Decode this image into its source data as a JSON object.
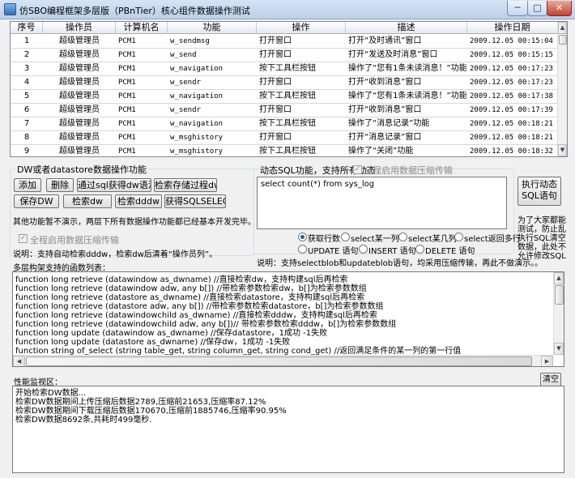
{
  "window": {
    "title": "仿SBO编程框架多层版（PBnTier）核心组件数据操作测试",
    "min": "─",
    "max": "□",
    "close": "✕"
  },
  "grid": {
    "columns": [
      "序号",
      "操作员",
      "计算机名",
      "功能",
      "操作",
      "描述",
      "操作日期"
    ],
    "rows": [
      [
        "1",
        "超级管理员",
        "PCM1",
        "w_sendmsg",
        "打开窗口",
        "打开“及时通讯”窗口",
        "2009.12.05 00:15:04"
      ],
      [
        "2",
        "超级管理员",
        "PCM1",
        "w_send",
        "打开窗口",
        "打开“发送及时消息”窗口",
        "2009.12.05 00:15:15"
      ],
      [
        "3",
        "超级管理员",
        "PCM1",
        "w_navigation",
        "按下工具栏按钮",
        "操作了“您有1条未读消息！”功能",
        "2009.12.05 00:17:23"
      ],
      [
        "4",
        "超级管理员",
        "PCM1",
        "w_sendr",
        "打开窗口",
        "打开“收到消息”窗口",
        "2009.12.05 00:17:23"
      ],
      [
        "5",
        "超级管理员",
        "PCM1",
        "w_navigation",
        "按下工具栏按钮",
        "操作了“您有1条未读消息！”功能",
        "2009.12.05 00:17:38"
      ],
      [
        "6",
        "超级管理员",
        "PCM1",
        "w_sendr",
        "打开窗口",
        "打开“收到消息”窗口",
        "2009.12.05 00:17:39"
      ],
      [
        "7",
        "超级管理员",
        "PCM1",
        "w_navigation",
        "按下工具栏按钮",
        "操作了“消息记录”功能",
        "2009.12.05 00:18:21"
      ],
      [
        "8",
        "超级管理员",
        "PCM1",
        "w_msghistory",
        "打开窗口",
        "打开“消息记录”窗口",
        "2009.12.05 00:18:21"
      ],
      [
        "9",
        "超级管理员",
        "PCM1",
        "w_msghistory",
        "按下工具栏按钮",
        "操作了“关闭”功能",
        "2009.12.05 00:18:32"
      ]
    ]
  },
  "dw_group": {
    "title": "DW或者datastore数据操作功能",
    "buttons": [
      "添加",
      "删除",
      "通过sql获得dw语法",
      "检索存储过程dw",
      "保存DW",
      "检索dw",
      "检索dddw",
      "获得SQLSELECT"
    ],
    "other_text": "其他功能暂不演示，两层下所有数据操作功能都已经基本开发完毕。",
    "compress_label": "全程启用数据压缩传输",
    "note": "说明：支持自动检索dddw，检索dw后清着“操作员列”。"
  },
  "sql_group": {
    "title": "动态SQL功能，支持所有动态",
    "compress_label": "全程启用数据压缩传输",
    "query": "select count(*) from sys_log",
    "exec_button": "执行动态SQL语句",
    "side_note": [
      "为了大家都能",
      "测试，防止乱",
      "执行SQL清空",
      "数据，此处不",
      "允许修改SQL"
    ],
    "radios": [
      {
        "label": "获取行数",
        "selected": true
      },
      {
        "label": "select某一列",
        "selected": false
      },
      {
        "label": "select某几列",
        "selected": false
      },
      {
        "label": "select返回多行",
        "selected": false
      },
      {
        "label": "UPDATE 语句",
        "selected": false
      },
      {
        "label": "INSERT 语句",
        "selected": false
      },
      {
        "label": "DELETE 语句",
        "selected": false
      }
    ],
    "note": "说明：支持selectblob和updateblob语句，均采用压缩传输，再此不做演示。。"
  },
  "functions": {
    "label": "多层构架支持的函数列表：",
    "lines": [
      "function long retrieve (datawindow as_dwname) //直接检索dw，支持构建sql后再检索",
      "function long retrieve (datawindow adw, any b[]) //带检索参数检索dw，b[]为检索参数数组",
      "function long retrieve (datastore as_dwname) //直接检索datastore，支持构建sql后再检索",
      "function long retrieve (datastore adw, any b[]) //带检索参数检索datastore，b[]为检索参数数组",
      "function long retrieve (datawindowchild as_dwname) //直接检索dddw，支持构建sql后再检索",
      "function long retrieve (datawindowchild adw, any b[])// 带检索参数检索dddw，b[]为检索参数数组",
      "function long update (datawindow as_dwname) //保存datastore，1成功 -1失败",
      "function long update (datastore as_dwname) //保存dw，1成功 -1失败",
      "function string of_select (string table_get, string column_get, string cond_get) //返回满足条件的某一列的第一行值"
    ]
  },
  "perf": {
    "label": "性能监视区：",
    "clear_button": "清空",
    "lines": [
      "开始检索DW数据...",
      "检索DW数据期间上传压缩后数据2789,压缩前21653,压缩率87.12%",
      "检索DW数据期间下载压缩后数据170670,压缩前1885746,压缩率90.95%",
      "检索DW数据8692条,共耗时499毫秒."
    ]
  },
  "colors": {
    "titlebar": "#c9dbef",
    "grid_header": "#eceef2",
    "window_bg": "#f0f0f0",
    "radio_dot": "#2a5aa0"
  },
  "icons": {
    "app": "app-icon",
    "scroll_up": "chevron-up-icon",
    "scroll_down": "chevron-down-icon",
    "scroll_left": "chevron-left-icon",
    "scroll_right": "chevron-right-icon"
  }
}
